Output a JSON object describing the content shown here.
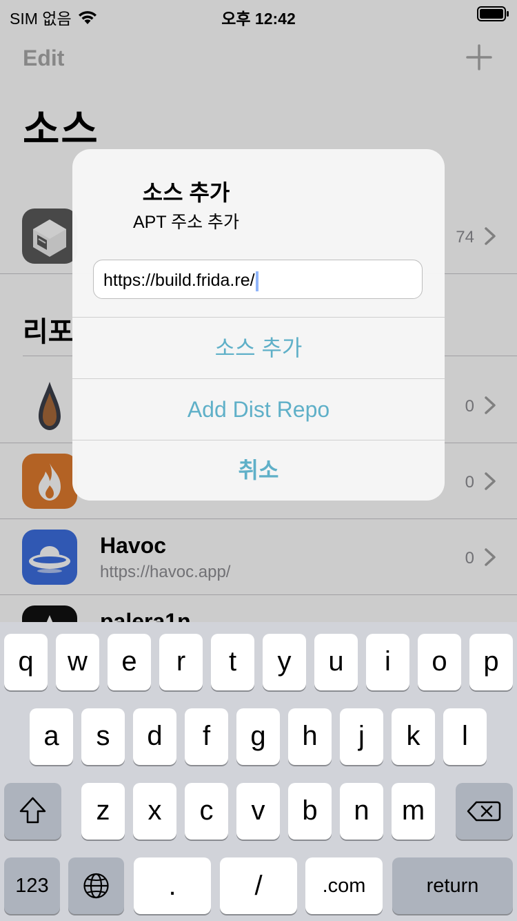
{
  "status_bar": {
    "carrier": "SIM 없음",
    "time": "오후 12:42"
  },
  "nav": {
    "edit_label": "Edit"
  },
  "page_title": "소스",
  "sources_row": {
    "count": "74"
  },
  "section_title": "리포",
  "repo_rows": [
    {
      "name": "",
      "url": "",
      "count": "0"
    },
    {
      "name": "",
      "url": "",
      "count": "0"
    },
    {
      "name": "Havoc",
      "url": "https://havoc.app/",
      "count": "0"
    },
    {
      "name": "palera1n",
      "url": "",
      "count": ""
    }
  ],
  "alert": {
    "title": "소스 추가",
    "message": "APT 주소 추가",
    "input_value": "https://build.frida.re/",
    "buttons": [
      "소스 추가",
      "Add Dist Repo",
      "취소"
    ],
    "button_color": "#5fb0c8"
  },
  "keyboard": {
    "row1": [
      "q",
      "w",
      "e",
      "r",
      "t",
      "y",
      "u",
      "i",
      "o",
      "p"
    ],
    "row2": [
      "a",
      "s",
      "d",
      "f",
      "g",
      "h",
      "j",
      "k",
      "l"
    ],
    "row3": [
      "z",
      "x",
      "c",
      "v",
      "b",
      "n",
      "m"
    ],
    "numbers_label": "123",
    "dot_label": ".",
    "slash_label": "/",
    "dotcom_label": ".com",
    "return_label": "return"
  }
}
